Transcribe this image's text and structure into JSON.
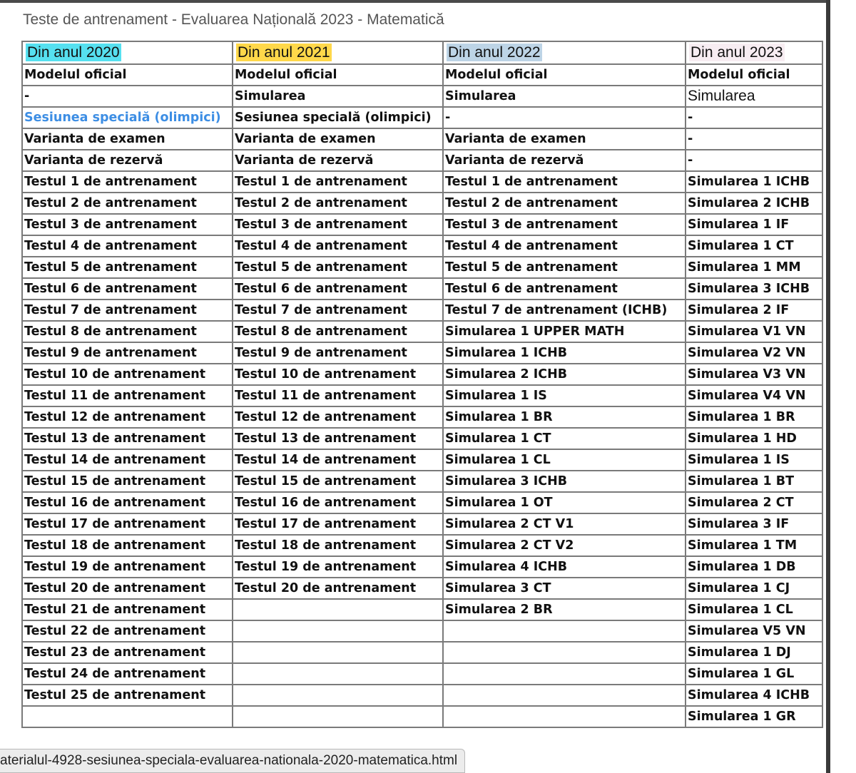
{
  "page": {
    "title": "Teste de antrenament - Evaluarea Națională 2023 - Matematică"
  },
  "table": {
    "headers": [
      "Din anul 2020",
      "Din anul 2021",
      "Din anul 2022",
      "Din anul 2023"
    ],
    "rows": [
      [
        "Modelul oficial",
        "Modelul oficial",
        "Modelul oficial",
        "Modelul oficial"
      ],
      [
        "-",
        "Simularea",
        "Simularea",
        "Simularea"
      ],
      [
        "Sesiunea specială (olimpici)",
        "Sesiunea specială (olimpici)",
        "-",
        "-"
      ],
      [
        "Varianta de examen",
        "Varianta de examen",
        "Varianta de examen",
        "-"
      ],
      [
        "Varianta de rezervă",
        "Varianta de rezervă",
        "Varianta de rezervă",
        "-"
      ],
      [
        "Testul 1 de antrenament",
        "Testul 1 de antrenament",
        "Testul 1 de antrenament",
        "Simularea 1 ICHB"
      ],
      [
        "Testul 2 de antrenament",
        "Testul 2 de antrenament",
        "Testul 2 de antrenament",
        "Simularea 2 ICHB"
      ],
      [
        "Testul 3 de antrenament",
        "Testul 3 de antrenament",
        "Testul 3 de antrenament",
        "Simularea 1 IF"
      ],
      [
        "Testul 4 de antrenament",
        "Testul 4 de antrenament",
        "Testul 4 de antrenament",
        "Simularea 1 CT"
      ],
      [
        "Testul 5 de antrenament",
        "Testul 5 de antrenament",
        "Testul 5 de antrenament",
        "Simularea 1 MM"
      ],
      [
        "Testul 6 de antrenament",
        "Testul 6 de antrenament",
        "Testul 6 de antrenament",
        "Simularea 3 ICHB"
      ],
      [
        "Testul 7 de antrenament",
        "Testul 7 de antrenament",
        "Testul 7 de antrenament (ICHB)",
        "Simularea 2 IF"
      ],
      [
        "Testul 8 de antrenament",
        "Testul 8 de antrenament",
        "Simularea 1 UPPER MATH",
        "Simularea V1 VN"
      ],
      [
        "Testul 9 de antrenament",
        "Testul 9 de antrenament",
        "Simularea 1 ICHB",
        "Simularea V2 VN"
      ],
      [
        "Testul 10 de antrenament",
        "Testul 10 de antrenament",
        "Simularea 2 ICHB",
        "Simularea V3 VN"
      ],
      [
        "Testul 11 de antrenament",
        "Testul 11 de antrenament",
        "Simularea 1 IS",
        "Simularea V4 VN"
      ],
      [
        "Testul 12 de antrenament",
        "Testul 12 de antrenament",
        "Simularea 1 BR",
        "Simularea 1 BR"
      ],
      [
        "Testul 13 de antrenament",
        "Testul 13 de antrenament",
        "Simularea 1 CT",
        "Simularea 1 HD"
      ],
      [
        "Testul 14 de antrenament",
        "Testul 14 de antrenament",
        "Simularea 1 CL",
        "Simularea 1 IS"
      ],
      [
        "Testul 15 de antrenament",
        "Testul 15 de antrenament",
        "Simularea 3 ICHB",
        "Simularea 1 BT"
      ],
      [
        "Testul 16 de antrenament",
        "Testul 16 de antrenament",
        "Simularea 1 OT",
        "Simularea 2 CT"
      ],
      [
        "Testul 17 de antrenament",
        "Testul 17 de antrenament",
        "Simularea 2 CT V1",
        "Simularea 3 IF"
      ],
      [
        "Testul 18 de antrenament",
        "Testul 18 de antrenament",
        "Simularea 2 CT V2",
        "Simularea 1 TM"
      ],
      [
        "Testul 19 de antrenament",
        "Testul 19 de antrenament",
        "Simularea 4 ICHB",
        "Simularea 1 DB"
      ],
      [
        "Testul 20 de antrenament",
        "Testul 20 de antrenament",
        "Simularea 3 CT",
        "Simularea 1 CJ"
      ],
      [
        "Testul 21 de antrenament",
        "",
        "Simularea 2 BR",
        "Simularea 1 CL"
      ],
      [
        "Testul 22 de antrenament",
        "",
        "",
        "Simularea V5 VN"
      ],
      [
        "Testul 23 de antrenament",
        "",
        "",
        "Simularea 1 DJ"
      ],
      [
        "Testul 24 de antrenament",
        "",
        "",
        "Simularea 1 GL"
      ],
      [
        "Testul 25 de antrenament",
        "",
        "",
        "Simularea 4 ICHB"
      ],
      [
        "",
        "",
        "",
        "Simularea 1 GR"
      ]
    ]
  },
  "status_bar": {
    "url": "aterialul-4928-sesiunea-speciala-evaluarea-nationala-2020-matematica.html"
  },
  "colors": {
    "highlight_2020": "#56e0f0",
    "highlight_2021": "#ffd84a",
    "highlight_2022": "#bdd4e6",
    "highlight_2023": "#f7edf2",
    "link": "#3d8ee4"
  }
}
